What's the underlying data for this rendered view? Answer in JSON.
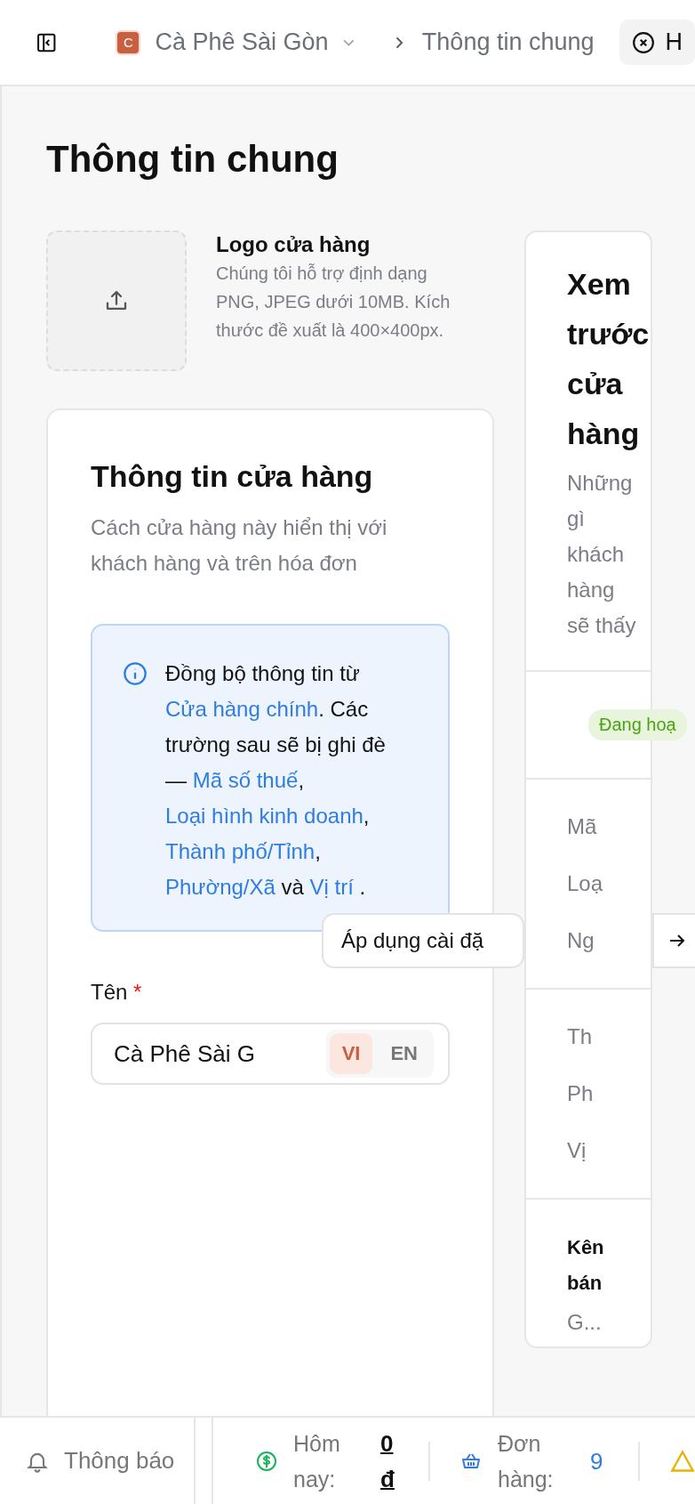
{
  "top_bar": {
    "store": {
      "initial": "C",
      "name": "Cà Phê Sài Gòn"
    },
    "breadcrumb": "Thông tin chung",
    "tab": {
      "label": "H"
    }
  },
  "page_title": "Thông tin chung",
  "logo": {
    "title": "Logo cửa hàng",
    "description": "Chúng tôi hỗ trợ định dạng PNG, JPEG dưới 10MB. Kích thước đề xuất là 400×400px."
  },
  "store_card": {
    "title": "Thông tin cửa hàng",
    "subtitle": "Cách cửa hàng này hiển thị với khách hàng và trên hóa đơn",
    "notice": [
      {
        "text": "Đồng bộ thông tin từ ",
        "link": false
      },
      {
        "text": "Cửa hàng chính",
        "link": true
      },
      {
        "text": ". Các trường sau sẽ bị ghi đè — ",
        "link": false
      },
      {
        "text": "Mã số thuế",
        "link": true
      },
      {
        "text": ", ",
        "link": false
      },
      {
        "text": "Loại hình kinh doanh",
        "link": true
      },
      {
        "text": ", ",
        "link": false
      },
      {
        "text": "Thành phố/Tỉnh",
        "link": true
      },
      {
        "text": ", ",
        "link": false
      },
      {
        "text": "Phường/Xã",
        "link": true
      },
      {
        "text": " và ",
        "link": false
      },
      {
        "text": "Vị trí",
        "link": true
      },
      {
        "text": " .",
        "link": false
      }
    ],
    "name_field": {
      "label": "Tên",
      "required_mark": "*",
      "value": "Cà Phê Sài G",
      "languages": [
        {
          "label": "VI",
          "selected": true
        },
        {
          "label": "EN",
          "selected": false
        }
      ]
    }
  },
  "apply_button": {
    "label": "Áp dụng cài đặ"
  },
  "preview": {
    "title": "Xem trước cửa hàng",
    "subtitle": "Những gì khách hàng sẽ thấy",
    "status": "Đang hoạ",
    "groups": [
      [
        "Mã",
        "Loạ",
        "Ng"
      ],
      [
        "Th",
        "Ph",
        "Vị"
      ]
    ],
    "channels": {
      "title": "Kên bán",
      "value": "G..."
    }
  },
  "status_bar": {
    "notifications": "Thông báo",
    "today": {
      "label": "Hôm nay:",
      "value": "0 đ"
    },
    "orders": {
      "label": "Đơn hàng:",
      "value": "9"
    }
  }
}
